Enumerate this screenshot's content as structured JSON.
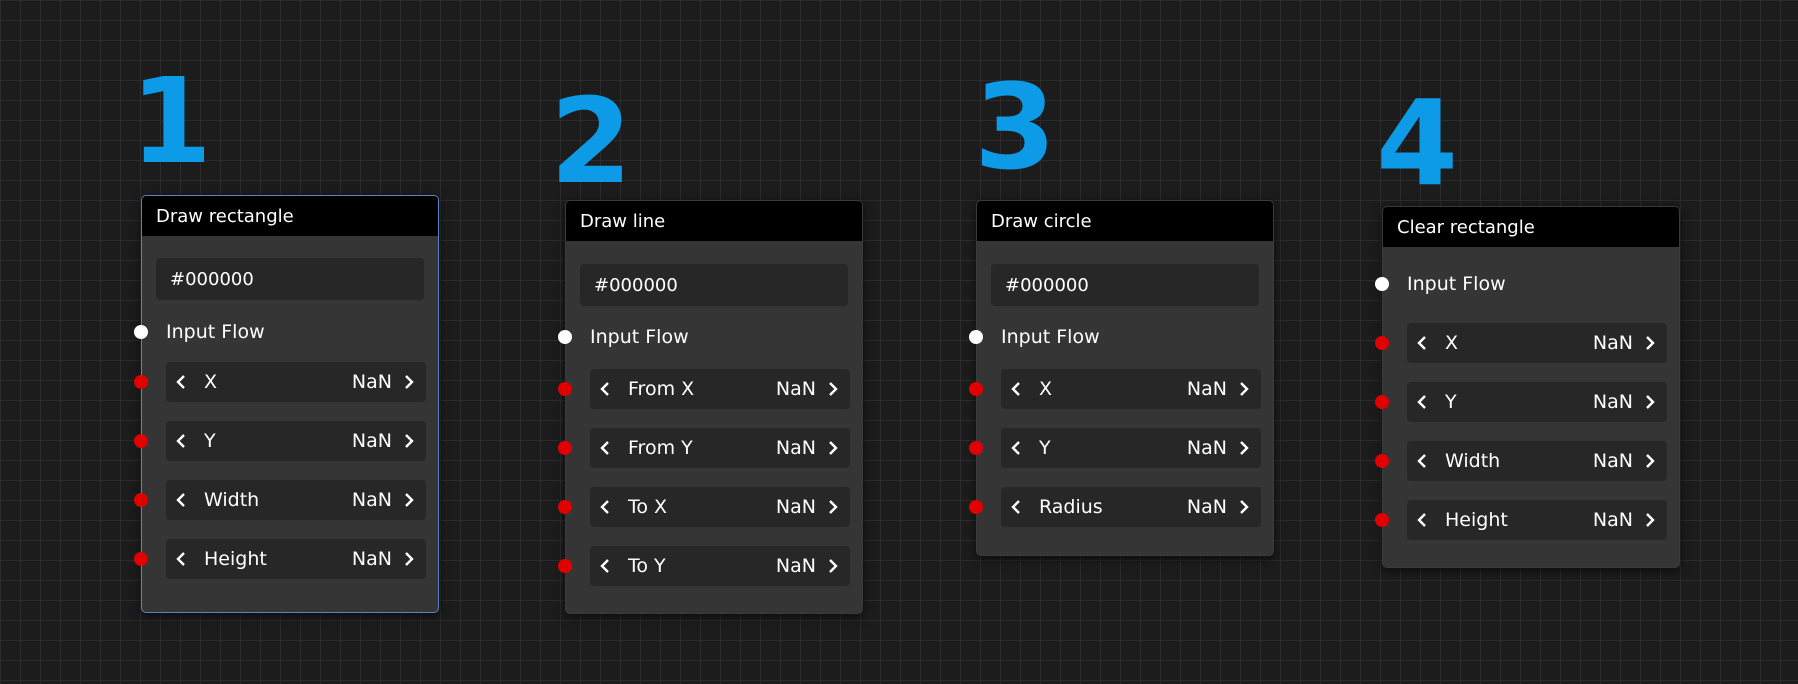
{
  "nodes": [
    {
      "step": "1",
      "title": "Draw rectangle",
      "color": "#000000",
      "flow_label": "Input Flow",
      "params": [
        {
          "label": "X",
          "value": "NaN"
        },
        {
          "label": "Y",
          "value": "NaN"
        },
        {
          "label": "Width",
          "value": "NaN"
        },
        {
          "label": "Height",
          "value": "NaN"
        }
      ]
    },
    {
      "step": "2",
      "title": "Draw line",
      "color": "#000000",
      "flow_label": "Input Flow",
      "params": [
        {
          "label": "From X",
          "value": "NaN"
        },
        {
          "label": "From Y",
          "value": "NaN"
        },
        {
          "label": "To X",
          "value": "NaN"
        },
        {
          "label": "To Y",
          "value": "NaN"
        }
      ]
    },
    {
      "step": "3",
      "title": "Draw circle",
      "color": "#000000",
      "flow_label": "Input Flow",
      "params": [
        {
          "label": "X",
          "value": "NaN"
        },
        {
          "label": "Y",
          "value": "NaN"
        },
        {
          "label": "Radius",
          "value": "NaN"
        }
      ]
    },
    {
      "step": "4",
      "title": "Clear rectangle",
      "flow_label": "Input Flow",
      "params": [
        {
          "label": "X",
          "value": "NaN"
        },
        {
          "label": "Y",
          "value": "NaN"
        },
        {
          "label": "Width",
          "value": "NaN"
        },
        {
          "label": "Height",
          "value": "NaN"
        }
      ]
    }
  ],
  "colors": {
    "step_number": "#0d9be8",
    "flow_port": "#ffffff",
    "value_port": "#e00000",
    "selection_border": "#5b82c9"
  },
  "icons": {
    "decrement": "chevron-left-icon",
    "increment": "chevron-right-icon",
    "flow_port": "flow-port-icon",
    "value_port": "input-port-icon"
  }
}
